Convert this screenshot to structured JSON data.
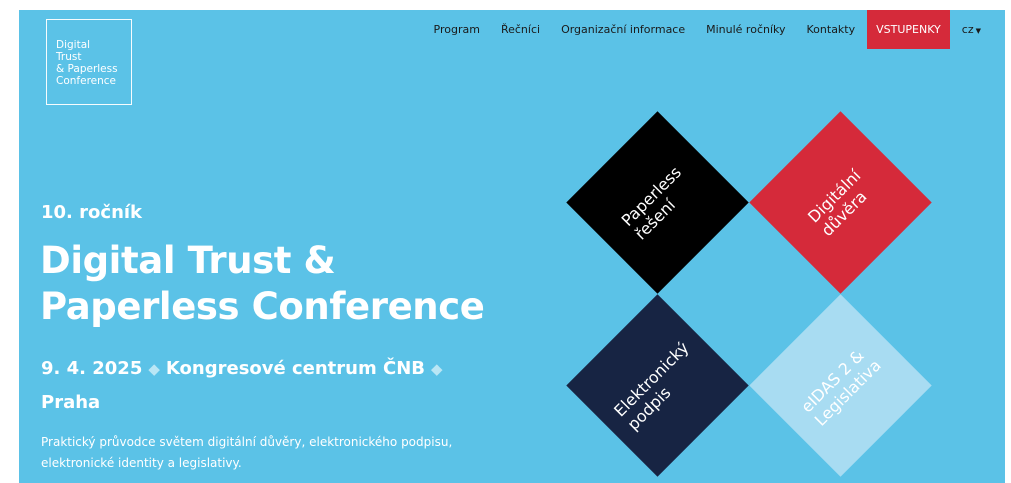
{
  "logo": {
    "lines": [
      "Digital",
      "Trust",
      "& Paperless",
      "Conference"
    ]
  },
  "nav": {
    "items": [
      "Program",
      "Řečníci",
      "Organizační informace",
      "Minulé ročníky",
      "Kontakty"
    ],
    "tickets": "VSTUPENKY",
    "lang": "cz",
    "lang_icon": "caret-down",
    "colors": {
      "tickets_bg": "#d52a3a"
    }
  },
  "hero": {
    "background": "#5bc2e7",
    "edition": "10. ročník",
    "title_lines": [
      "Digital Trust &",
      "Paperless Conference"
    ],
    "date": "9. 4. 2025",
    "venue": "Kongresové centrum ČNB",
    "city": "Praha",
    "separator_icon": "diamond",
    "description": "Praktický průvodce světem digitální důvěry, elektronického podpisu, elektronické identity a legislativy."
  },
  "topics": [
    {
      "lines": [
        "Paperless",
        "řešení"
      ],
      "color": "#000000"
    },
    {
      "lines": [
        "Digitální",
        "důvěra"
      ],
      "color": "#d52a3a"
    },
    {
      "lines": [
        "Elektronický",
        "podpis"
      ],
      "color": "#172443"
    },
    {
      "lines": [
        "eIDAS 2 &",
        "Legislativa"
      ],
      "color": "#a8dcf2"
    }
  ]
}
